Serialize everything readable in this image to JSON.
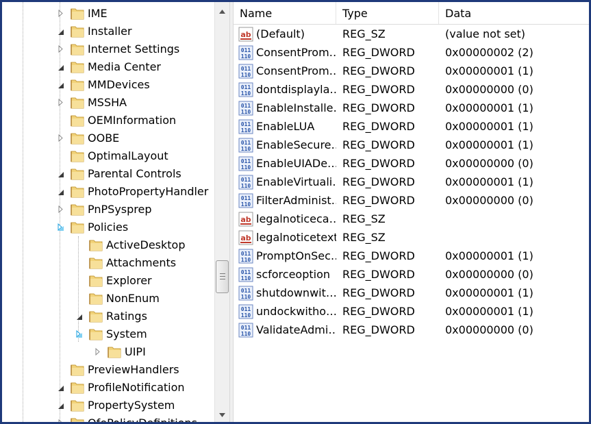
{
  "tree": {
    "items": [
      {
        "label": "IME",
        "level": 0,
        "expander": "collapsed"
      },
      {
        "label": "Installer",
        "level": 0,
        "expander": "expanded"
      },
      {
        "label": "Internet Settings",
        "level": 0,
        "expander": "collapsed"
      },
      {
        "label": "Media Center",
        "level": 0,
        "expander": "expanded"
      },
      {
        "label": "MMDevices",
        "level": 0,
        "expander": "expanded"
      },
      {
        "label": "MSSHA",
        "level": 0,
        "expander": "collapsed"
      },
      {
        "label": "OEMInformation",
        "level": 0,
        "expander": "none"
      },
      {
        "label": "OOBE",
        "level": 0,
        "expander": "collapsed"
      },
      {
        "label": "OptimalLayout",
        "level": 0,
        "expander": "none"
      },
      {
        "label": "Parental Controls",
        "level": 0,
        "expander": "expanded"
      },
      {
        "label": "PhotoPropertyHandler",
        "level": 0,
        "expander": "expanded"
      },
      {
        "label": "PnPSysprep",
        "level": 0,
        "expander": "collapsed"
      },
      {
        "label": "Policies",
        "level": 0,
        "expander": "open"
      },
      {
        "label": "ActiveDesktop",
        "level": 1,
        "expander": "none"
      },
      {
        "label": "Attachments",
        "level": 1,
        "expander": "none"
      },
      {
        "label": "Explorer",
        "level": 1,
        "expander": "none"
      },
      {
        "label": "NonEnum",
        "level": 1,
        "expander": "none"
      },
      {
        "label": "Ratings",
        "level": 1,
        "expander": "expanded"
      },
      {
        "label": "System",
        "level": 1,
        "expander": "open"
      },
      {
        "label": "UIPI",
        "level": 2,
        "expander": "collapsed"
      },
      {
        "label": "PreviewHandlers",
        "level": 0,
        "expander": "none"
      },
      {
        "label": "ProfileNotification",
        "level": 0,
        "expander": "expanded"
      },
      {
        "label": "PropertySystem",
        "level": 0,
        "expander": "expanded"
      },
      {
        "label": "QfePolicyDefinitions",
        "level": 0,
        "expander": "collapsed"
      }
    ]
  },
  "list": {
    "headers": {
      "name": "Name",
      "type": "Type",
      "data": "Data"
    },
    "rows": [
      {
        "icon": "string-value-icon",
        "name": "(Default)",
        "type": "REG_SZ",
        "data": "(value not set)"
      },
      {
        "icon": "binary-value-icon",
        "name": "ConsentProm…",
        "type": "REG_DWORD",
        "data": "0x00000002 (2)"
      },
      {
        "icon": "binary-value-icon",
        "name": "ConsentProm…",
        "type": "REG_DWORD",
        "data": "0x00000001 (1)"
      },
      {
        "icon": "binary-value-icon",
        "name": "dontdisplayla…",
        "type": "REG_DWORD",
        "data": "0x00000000 (0)"
      },
      {
        "icon": "binary-value-icon",
        "name": "EnableInstalle…",
        "type": "REG_DWORD",
        "data": "0x00000001 (1)"
      },
      {
        "icon": "binary-value-icon",
        "name": "EnableLUA",
        "type": "REG_DWORD",
        "data": "0x00000001 (1)"
      },
      {
        "icon": "binary-value-icon",
        "name": "EnableSecure…",
        "type": "REG_DWORD",
        "data": "0x00000001 (1)"
      },
      {
        "icon": "binary-value-icon",
        "name": "EnableUIADe…",
        "type": "REG_DWORD",
        "data": "0x00000000 (0)"
      },
      {
        "icon": "binary-value-icon",
        "name": "EnableVirtuali…",
        "type": "REG_DWORD",
        "data": "0x00000001 (1)"
      },
      {
        "icon": "binary-value-icon",
        "name": "FilterAdminist…",
        "type": "REG_DWORD",
        "data": "0x00000000 (0)"
      },
      {
        "icon": "string-value-icon",
        "name": "legalnoticeca…",
        "type": "REG_SZ",
        "data": ""
      },
      {
        "icon": "string-value-icon",
        "name": "legalnoticetext",
        "type": "REG_SZ",
        "data": ""
      },
      {
        "icon": "binary-value-icon",
        "name": "PromptOnSec…",
        "type": "REG_DWORD",
        "data": "0x00000001 (1)"
      },
      {
        "icon": "binary-value-icon",
        "name": "scforceoption",
        "type": "REG_DWORD",
        "data": "0x00000000 (0)"
      },
      {
        "icon": "binary-value-icon",
        "name": "shutdownwit…",
        "type": "REG_DWORD",
        "data": "0x00000001 (1)"
      },
      {
        "icon": "binary-value-icon",
        "name": "undockwitho…",
        "type": "REG_DWORD",
        "data": "0x00000001 (1)"
      },
      {
        "icon": "binary-value-icon",
        "name": "ValidateAdmi…",
        "type": "REG_DWORD",
        "data": "0x00000000 (0)"
      }
    ]
  },
  "colors": {
    "frame": "#1f3a7a",
    "folder": "#f2d37a",
    "folder_edge": "#c8a040",
    "binary_icon": "#2a55a8",
    "string_icon": "#c0392b"
  }
}
